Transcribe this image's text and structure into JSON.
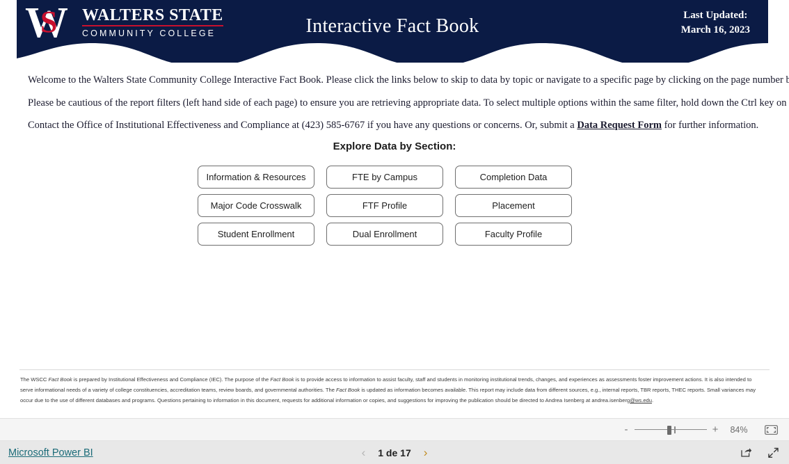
{
  "header": {
    "logo": {
      "mark_w": "W",
      "mark_s": "S",
      "line1": "WALTERS STATE",
      "line2": "COMMUNITY COLLEGE"
    },
    "title": "Interactive Fact Book",
    "updated_label": "Last Updated:",
    "updated_date": "March 16, 2023",
    "banner_color": "#0b1b45",
    "accent_color": "#c8102e"
  },
  "body": {
    "paragraph1": "Welcome to the Walters State Community College Interactive Fact Book.  Please click the links below to skip to data by topic or navigate to a specific page by clicking on the page number below.",
    "paragraph2": "Please be cautious of the report filters (left hand side of each page) to ensure you are retrieving appropriate data. To select multiple options within the same filter, hold down the Ctrl key on your keyboard.",
    "paragraph3_before": "Contact the Office of Institutional Effectiveness and Compliance at (423) 585-6767 if you have any questions or concerns. Or, submit a ",
    "paragraph3_link": "Data Request Form",
    "paragraph3_after": " for further information."
  },
  "explore": {
    "title": "Explore Data by Section:",
    "buttons": [
      {
        "label": "Information & Resources"
      },
      {
        "label": "FTE by Campus"
      },
      {
        "label": "Completion Data"
      },
      {
        "label": "Major Code Crosswalk"
      },
      {
        "label": "FTF Profile"
      },
      {
        "label": "Placement"
      },
      {
        "label": "Student Enrollment"
      },
      {
        "label": "Dual Enrollment"
      },
      {
        "label": "Faculty Profile"
      }
    ]
  },
  "disclaimer": {
    "s1": "The WSCC ",
    "i1": "Fact Book",
    "s2": " is prepared by Institutional Effectiveness and Compliance (IEC).  The purpose of the ",
    "i2": "Fact Book",
    "s3": " is to provide access to information to assist faculty, staff and students in monitoring institutional trends, changes, and experiences as assessments foster improvement actions. It is also intended to serve informational needs of a variety of college constituencies, accreditation teams, review boards, and governmental authorities. The ",
    "i3": "Fact Book",
    "s4": " is updated as information becomes available. This report may include data from different sources, e.g., internal reports, TBR reports, THEC reports. Small variances may occur due to the use of different databases and programs.  Questions pertaining to information in this document, requests for additional information or copies, and suggestions for improving the publication should be directed to Andrea Isenberg at andrea.isenberg",
    "email_link": "@ws.edu",
    "s5": "."
  },
  "zoombar": {
    "minus": "-",
    "plus": "+",
    "level": "84%",
    "fit_icon": "fit-to-page-icon"
  },
  "statusbar": {
    "powerbi_label": "Microsoft Power BI",
    "prev_icon": "chevron-left-icon",
    "page_label": "1 de 17",
    "next_icon": "chevron-right-icon",
    "share_icon": "share-icon",
    "fullscreen_icon": "fullscreen-icon"
  }
}
